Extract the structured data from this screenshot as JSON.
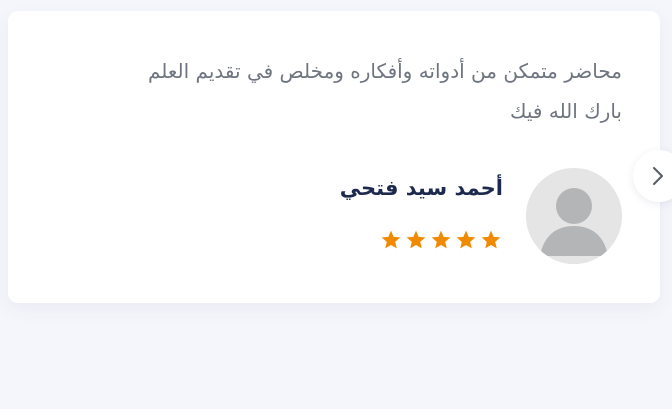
{
  "testimonial": {
    "review_lines": [
      "محاضر متمكن من أدواته وأفكاره ومخلص في تقديم العلم",
      "بارك الله فيك"
    ],
    "author_name": "أحمد سيد فتحي",
    "rating": 5,
    "rating_max": 5,
    "avatar_icon": "user-placeholder-icon",
    "colors": {
      "star": "#f08a00",
      "name": "#1d2a4d",
      "text": "#6f7580"
    }
  },
  "carousel": {
    "next_icon": "chevron-right-icon"
  }
}
